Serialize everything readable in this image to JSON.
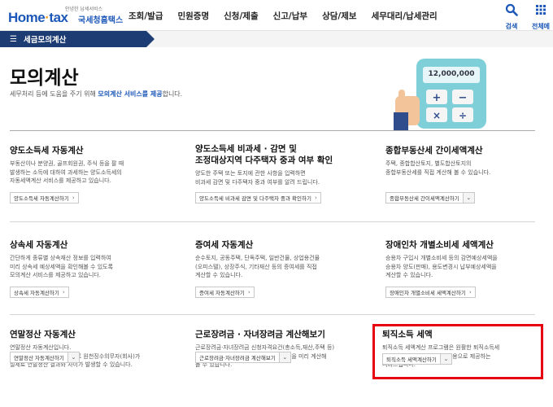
{
  "header": {
    "logo_tag": "안녕한 납세서비스",
    "logo_main_1": "Home",
    "logo_main_dot": "·",
    "logo_main_2": "tax",
    "logo_sub": "국세청홈택스",
    "nav": [
      "조회/발급",
      "민원증명",
      "신청/제출",
      "신고/납부",
      "상담/제보",
      "세무대리/납세관리"
    ],
    "search_label": "검색",
    "menu_label": "전체메"
  },
  "breadcrumb": {
    "label": "세금모의계산"
  },
  "page": {
    "title": "모의계산",
    "desc_prefix": "세무처리 등에 도움을 주기 위해 ",
    "desc_highlight": "모의계산 서비스를 제공",
    "desc_suffix": "합니다."
  },
  "illustration": {
    "amount": "12,000,000"
  },
  "cards": [
    {
      "title": "양도소득세 자동계산",
      "desc": [
        "부동산이나 분양권, 골프회원권, 주식 등을 팔 때",
        "발생하는 소득에 대하여 과세하는 양도소득세의",
        "자동세액계산 서비스를 제공하고 있습니다."
      ],
      "button": "양도소득세 자동계산하기"
    },
    {
      "title": "양도소득세 비과세 · 감면 및\n조정대상지역 다주택자 중과 여부 확인",
      "desc": [
        "양도한 주택 또는 토지에 관한 사항을 입력하면",
        "비과세 감면 및 다주택자 중과 여부를 알려 드립니다."
      ],
      "button": "양도소득세 비과세 감면 및 다주택자 중과 확인하기"
    },
    {
      "title": "종합부동산세 간이세액계산",
      "desc": [
        "주택, 종합합산토지, 별도합산토지의",
        "종합부동산세를 직접 계산해 볼 수 있습니다."
      ],
      "button": "종합부동산세 간이세액계산하기"
    },
    {
      "title": "상속세 자동계산",
      "desc": [
        "간단하게 종류별 상속재산 정보를 입력하여",
        "미리 상속세 예상세액을 확인해볼 수 있도록",
        "모의계산 서비스를 제공하고 있습니다."
      ],
      "button": "상속세 자동계산하기"
    },
    {
      "title": "증여세 자동계산",
      "desc": [
        "순수토지, 공동주택, 단독주택, 일반건물, 상업용건물",
        "(오피스텔), 상장주식, 기타재산 등의 증여세를 직접",
        "계산할 수 있습니다."
      ],
      "button": "증여세 자동계산하기"
    },
    {
      "title": "장애인차 개별소비세 세액계산",
      "desc": [
        "승용차 구입시 개별소비세 등의 감면예상세액을",
        "승용차 양도(판매), 용도변경시 납부예상세액을",
        "계산할 수 있습니다."
      ],
      "button": "장애인차 개별소비세 세액계산하기"
    },
    {
      "title": "연말정산 자동계산",
      "desc": [
        "연말정산 자동계산입니다.",
        "과세대상급여액의 차이 등으로 원천징수의무자(회사)가",
        "실제로 연말정산 결과와 차이가 발생할 수 있습니다."
      ],
      "button": "연말정산 자동계산하기"
    },
    {
      "title": "근로장려금 · 자녀장려금 계산해보기",
      "desc": [
        "근로장려금·자녀장려금 신청자격요건(총소득,재산,주택 등)",
        "을 입력하여 예상 근로장려금·자녀장려금을 미리 계산해",
        "볼 수 있습니다."
      ],
      "button": "근로장려금·자녀장려금 계산해보기"
    },
    {
      "title": "퇴직소득 세액",
      "desc": [
        "퇴직소득 세액계산 프로그램은 원활한 퇴직소득세",
        "신고 업무를 돕기 위하여 참고용으로 제공하는",
        "서비스입니다."
      ],
      "button": "퇴직소득 세액계산하기"
    }
  ],
  "colors": {
    "brand_blue": "#1d58b8",
    "crumb_navy": "#1e3c74",
    "highlight_red": "#e60012",
    "logo_orange": "#f39c1f"
  }
}
